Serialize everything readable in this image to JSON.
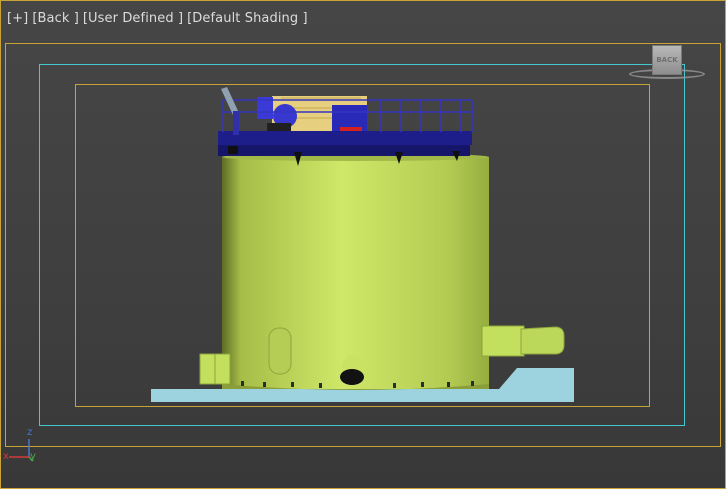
{
  "viewport": {
    "labels": [
      "[+]",
      "[Back ]",
      "[User Defined ]",
      "[Default Shading ]"
    ]
  },
  "viewcube": {
    "face_label": "BACK"
  },
  "axes": {
    "z": "z",
    "y": "y",
    "x": "x"
  },
  "colors": {
    "frame_border": "#c8a436",
    "safe_frame": "#45c8cf",
    "tank_body": "#c3df5e",
    "platform": "#1e1e8a",
    "base_slab": "#9dd3de"
  }
}
